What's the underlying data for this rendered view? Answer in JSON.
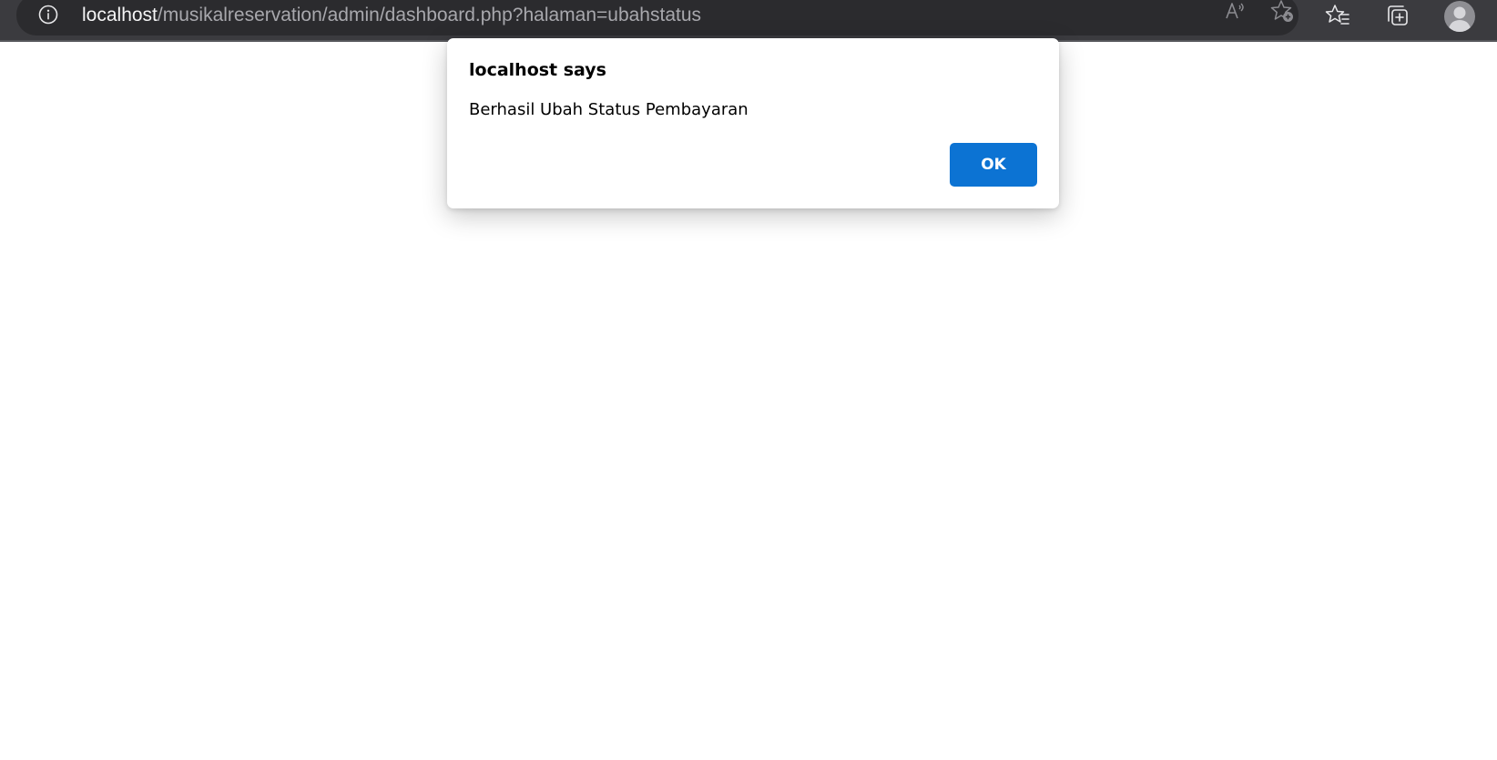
{
  "browser": {
    "url_host": "localhost",
    "url_path": "/musikalreservation/admin/dashboard.php?halaman=ubahstatus",
    "icons": {
      "site_info": "info-icon",
      "read_aloud": "read-aloud-icon",
      "add_favorite": "add-favorite-icon",
      "favorites": "favorites-icon",
      "collections": "collections-icon",
      "profile": "profile-avatar"
    }
  },
  "dialog": {
    "title": "localhost says",
    "message": "Berhasil Ubah Status Pembayaran",
    "ok_label": "OK"
  },
  "colors": {
    "toolbar": "#3b3b3f",
    "address_bar": "#2b2b2e",
    "accent": "#0c73d3"
  }
}
